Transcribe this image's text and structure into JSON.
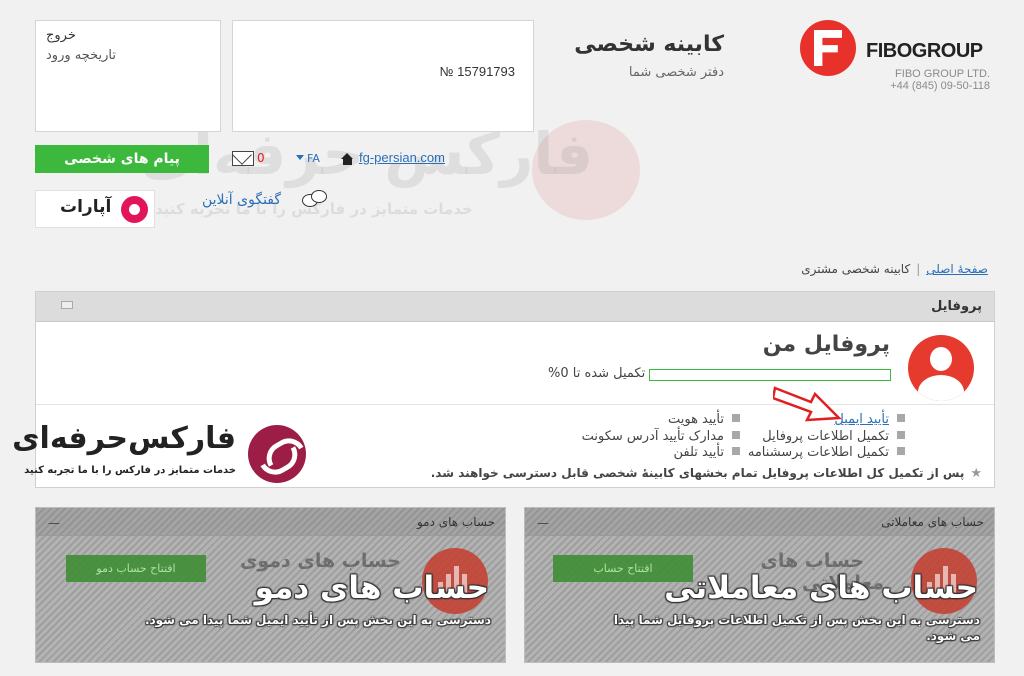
{
  "header": {
    "brand_name": "FIBOGROUP",
    "brand_company": "FIBO GROUP LTD.",
    "brand_phone": "+44 (845) 09-50-118",
    "cabinet_title": "کابینه شخصی",
    "cabinet_subtitle": "دفتر شخصی شما",
    "account_number": "№ 15791793",
    "exit_label": "خروج",
    "login_history_label": "تاریخچه ورود"
  },
  "toolbar": {
    "messages_button": "پیام های شخصی",
    "unread_count": "0",
    "language": "FA",
    "site_link": "fg-persian.com",
    "online_chat": "گفتگوی آنلاین",
    "aparat_label": "آپارات"
  },
  "watermark": {
    "title": "فارکس حرفه‌ای",
    "subtitle": "خدمات متمایز در فارکس را با ما تجربه کنید"
  },
  "breadcrumb": {
    "home": "صفحهٔ اصلی",
    "separator": "|",
    "current": "کابینه شخصی مشتری"
  },
  "profile": {
    "panel_title": "پروفایل",
    "name": "پروفایل من",
    "progress_text": "تکمیل شده تا 0%",
    "progress_value": 0,
    "tasks": [
      {
        "label": "تأیید ایمیل"
      },
      {
        "label": "تأیید هویت"
      },
      {
        "label": "تکمیل اطلاعات پروفایل"
      },
      {
        "label": "مدارک تأیید آدرس سکونت"
      },
      {
        "label": "تکمیل اطلاعات پرسشنامه"
      },
      {
        "label": "تأیید تلفن"
      }
    ],
    "note": "پس از تکمیل کل اطلاعات پروفایل تمام بخشهای کابینهٔ شخصی قابل دسترسی خواهند شد."
  },
  "badge": {
    "title": "فارکس‌حرفه‌ای",
    "subtitle": "خدمات متمایز در فارکس را با ما تجربه کنید"
  },
  "trading_panel": {
    "header": "حساب های معاملاتی",
    "open_button": "افتتاح حساب",
    "ghost_title_line1": "حساب های",
    "ghost_title_line2": "معاملاتی",
    "big_title": "حساب های معاملاتی",
    "description_line1": "دسترسی به این بخش پس از تکمیل اطلاعات پروفایل شما پیدا",
    "description_line2": "می شود.",
    "dash": "—"
  },
  "demo_panel": {
    "header": "حساب های دمو",
    "open_button": "افتتاح حساب دمو",
    "ghost_title": "حساب های دموی",
    "big_title": "حساب های دمو",
    "description": "دسترسی به این بخش پس از تأیید ایمیل شما پیدا می شود.",
    "dash": "—"
  },
  "colors": {
    "brand_red": "#e8312a",
    "green": "#3cb93c",
    "link_blue": "#2a6fb8"
  }
}
